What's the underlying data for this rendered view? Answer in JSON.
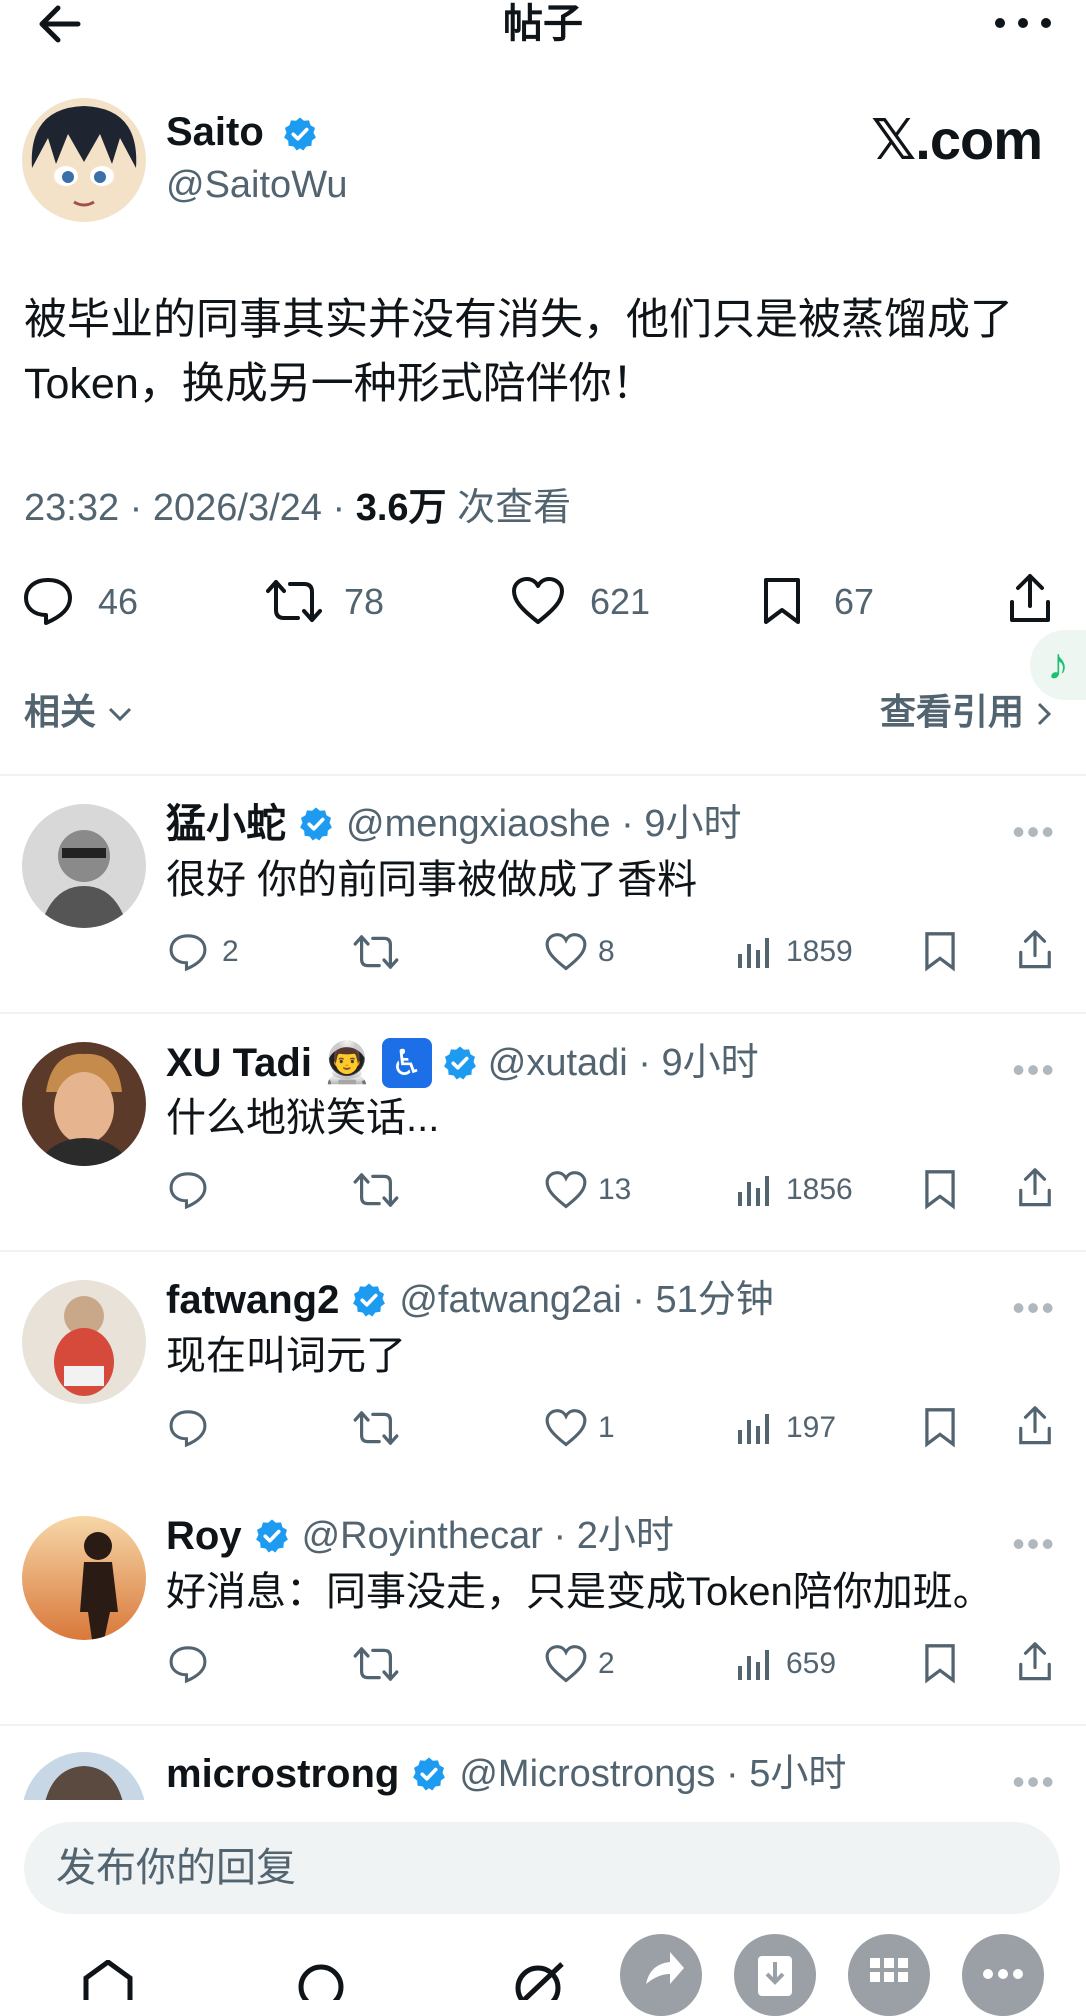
{
  "header": {
    "title": "帖子"
  },
  "post": {
    "author_name": "Saito",
    "author_handle": "@SaitoWu",
    "brand": "𝕏.com",
    "text": "被毕业的同事其实并没有消失，他们只是被蒸馏成了 Token，换成另一种形式陪伴你！",
    "time": "23:32 · 2026/3/24 · ",
    "views_bold": "3.6万",
    "views_suffix": " 次查看",
    "replies": "46",
    "retweets": "78",
    "likes": "621",
    "bookmarks": "67",
    "related_label": "相关",
    "quotes_label": "查看引用"
  },
  "replies": [
    {
      "name": "猛小蛇",
      "handle": "@mengxiaoshe · 9小时",
      "text": "很好 你的前同事被做成了香料",
      "replies": "2",
      "likes": "8",
      "views": "1859"
    },
    {
      "name": "XU Tadi",
      "handle": "@xutadi · 9小时",
      "text": "什么地狱笑话...",
      "replies": "",
      "likes": "13",
      "views": "1856"
    },
    {
      "name": "fatwang2",
      "handle": "@fatwang2ai · 51分钟",
      "text": "现在叫词元了",
      "replies": "",
      "likes": "1",
      "views": "197"
    },
    {
      "name": "Roy",
      "handle": "@Royinthecar · 2小时",
      "text": "好消息：同事没走，只是变成Token陪你加班。",
      "replies": "",
      "likes": "2",
      "views": "659"
    },
    {
      "name": "microstrong",
      "handle": "@Microstrongs · 5小时",
      "text": "",
      "replies": "",
      "likes": "",
      "views": ""
    }
  ],
  "composer": {
    "placeholder": "发布你的回复"
  },
  "colors": {
    "verified": "#1d9bf0",
    "muted": "#536471",
    "text": "#0f1419"
  }
}
